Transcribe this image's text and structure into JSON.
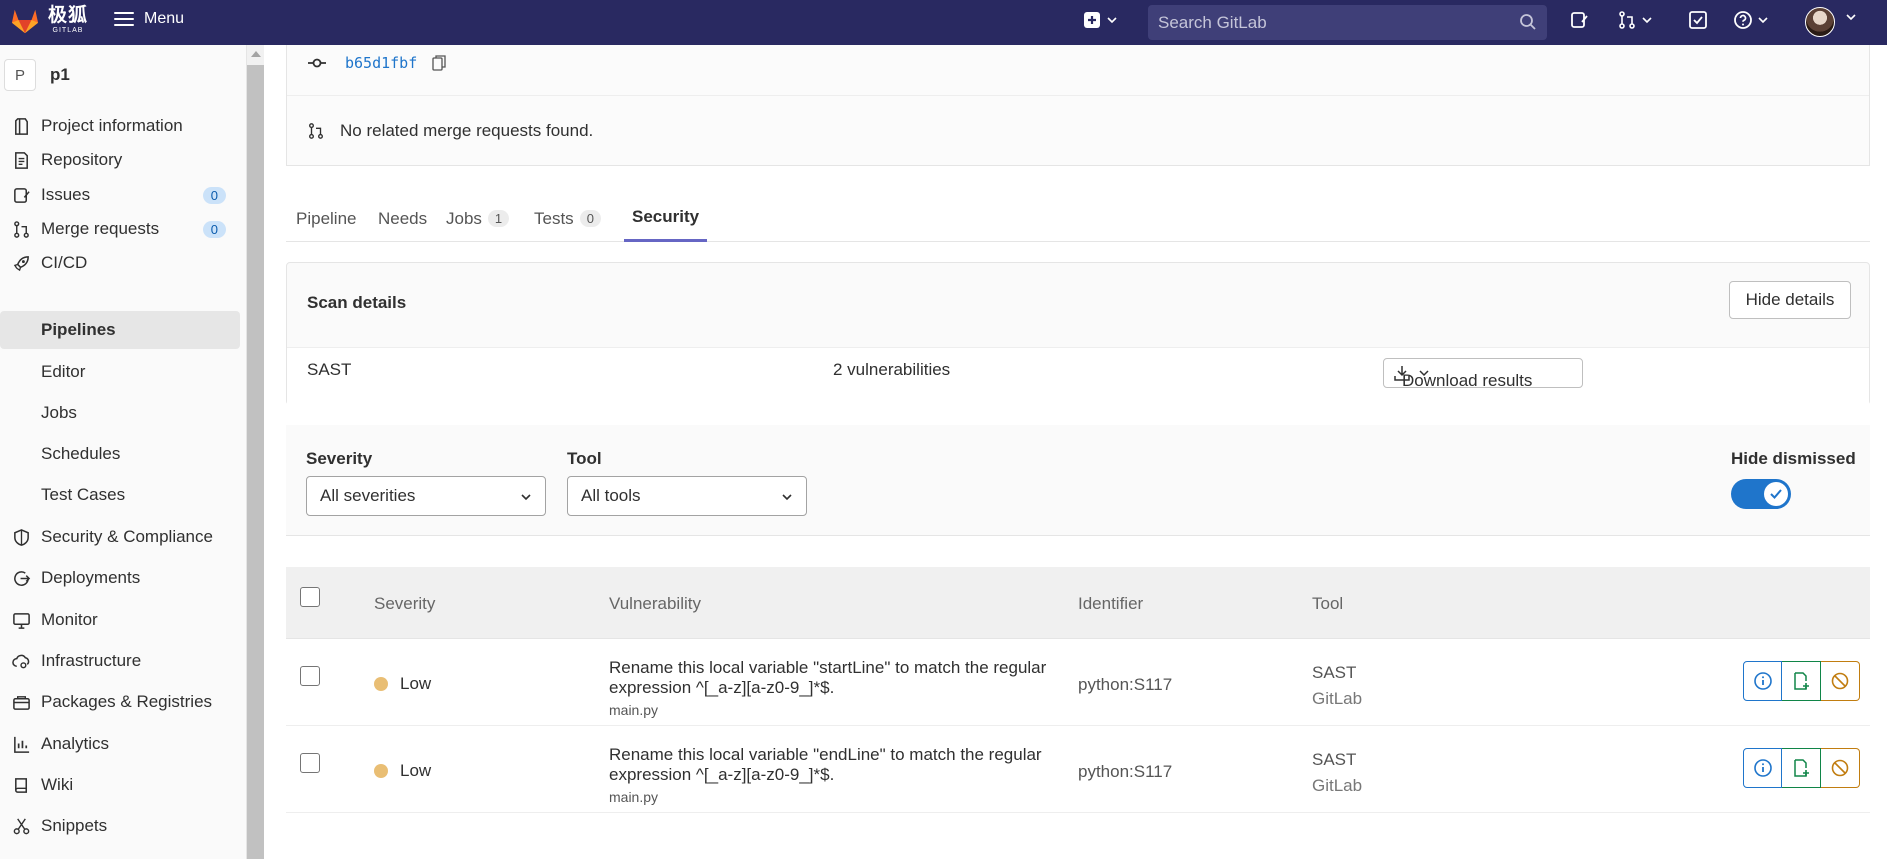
{
  "topbar": {
    "brand_cn": "极狐",
    "brand_en": "GITLAB",
    "menu_label": "Menu",
    "search_placeholder": "Search GitLab"
  },
  "sidebar": {
    "project_initial": "P",
    "project_name": "p1",
    "items": [
      {
        "label": "Project information",
        "icon": "project-info-icon"
      },
      {
        "label": "Repository",
        "icon": "repository-icon"
      },
      {
        "label": "Issues",
        "icon": "issues-icon",
        "badge": "0"
      },
      {
        "label": "Merge requests",
        "icon": "merge-request-icon",
        "badge": "0"
      },
      {
        "label": "CI/CD",
        "icon": "rocket-icon"
      },
      {
        "label": "Pipelines",
        "sub": true,
        "active": true
      },
      {
        "label": "Editor",
        "sub": true
      },
      {
        "label": "Jobs",
        "sub": true
      },
      {
        "label": "Schedules",
        "sub": true
      },
      {
        "label": "Test Cases",
        "sub": true
      },
      {
        "label": "Security & Compliance",
        "icon": "shield-icon"
      },
      {
        "label": "Deployments",
        "icon": "deployments-icon"
      },
      {
        "label": "Monitor",
        "icon": "monitor-icon"
      },
      {
        "label": "Infrastructure",
        "icon": "cloud-gear-icon"
      },
      {
        "label": "Packages & Registries",
        "icon": "package-icon"
      },
      {
        "label": "Analytics",
        "icon": "chart-icon"
      },
      {
        "label": "Wiki",
        "icon": "book-icon"
      },
      {
        "label": "Snippets",
        "icon": "scissors-icon"
      }
    ]
  },
  "commit": {
    "sha": "b65d1fbf",
    "mr_text": "No related merge requests found."
  },
  "tabs": [
    {
      "label": "Pipeline"
    },
    {
      "label": "Needs"
    },
    {
      "label": "Jobs",
      "count": "1"
    },
    {
      "label": "Tests",
      "count": "0"
    },
    {
      "label": "Security",
      "active": true
    }
  ],
  "scan": {
    "heading": "Scan details",
    "hide_details_label": "Hide details",
    "type": "SAST",
    "vuln_count": "2 vulnerabilities",
    "download_label": "Download results"
  },
  "filters": {
    "severity_label": "Severity",
    "severity_value": "All severities",
    "tool_label": "Tool",
    "tool_value": "All tools",
    "hide_dismissed_label": "Hide dismissed",
    "hide_dismissed_on": true
  },
  "table": {
    "headers": {
      "severity": "Severity",
      "vulnerability": "Vulnerability",
      "identifier": "Identifier",
      "tool": "Tool"
    },
    "rows": [
      {
        "severity": "Low",
        "title": "Rename this local variable \"startLine\" to match the regular expression ^[_a-z][a-z0-9_]*$.",
        "file": "main.py",
        "identifier": "python:S117",
        "tool": "SAST",
        "vendor": "GitLab"
      },
      {
        "severity": "Low",
        "title": "Rename this local variable \"endLine\" to match the regular expression ^[_a-z][a-z0-9_]*$.",
        "file": "main.py",
        "identifier": "python:S117",
        "tool": "SAST",
        "vendor": "GitLab"
      }
    ]
  },
  "colors": {
    "navbar": "#292961",
    "accent": "#1f75cb",
    "severity_low": "#e9be74",
    "tab_active": "#6666c4"
  }
}
